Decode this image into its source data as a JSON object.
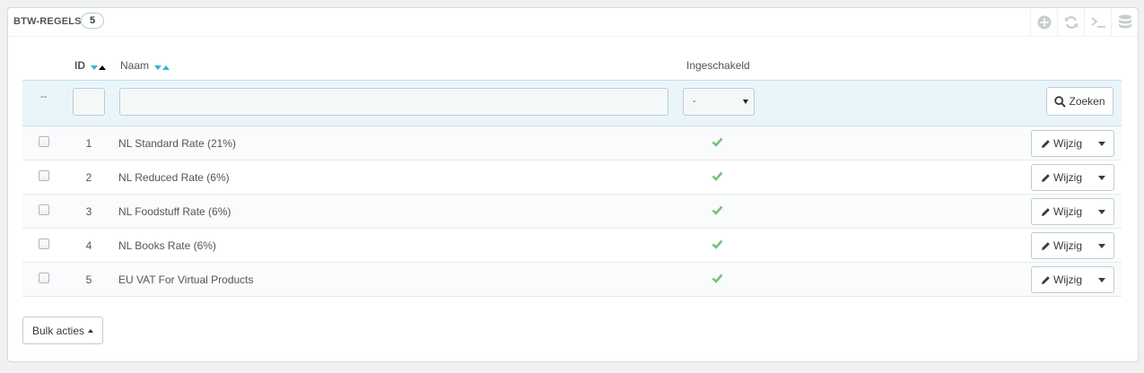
{
  "panel": {
    "title": "BTW-regels",
    "count": "5"
  },
  "toolbar": {
    "icons": [
      "plus-circle-icon",
      "refresh-icon",
      "terminal-icon",
      "database-icon"
    ]
  },
  "columns": {
    "id": "ID",
    "name": "Naam",
    "enabled": "Ingeschakeld"
  },
  "filters": {
    "dash": "--",
    "enabled_selected": "-",
    "search_label": "Zoeken"
  },
  "rows": [
    {
      "id": "1",
      "name": "NL Standard Rate (21%)",
      "enabled": true,
      "edit_label": "Wijzig"
    },
    {
      "id": "2",
      "name": "NL Reduced Rate (6%)",
      "enabled": true,
      "edit_label": "Wijzig"
    },
    {
      "id": "3",
      "name": "NL Foodstuff Rate (6%)",
      "enabled": true,
      "edit_label": "Wijzig"
    },
    {
      "id": "4",
      "name": "NL Books Rate (6%)",
      "enabled": true,
      "edit_label": "Wijzig"
    },
    {
      "id": "5",
      "name": "EU VAT For Virtual Products",
      "enabled": true,
      "edit_label": "Wijzig"
    }
  ],
  "bulk": {
    "label": "Bulk acties"
  },
  "colors": {
    "accent": "#25b9d7",
    "check": "#72c279",
    "filter_bg": "#eaf5fa"
  }
}
